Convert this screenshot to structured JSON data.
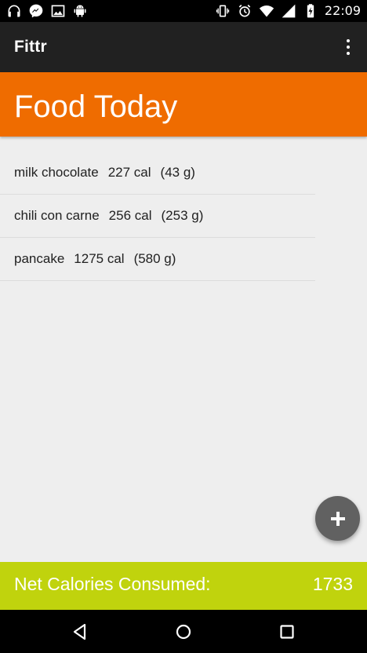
{
  "status_bar": {
    "time": "22:09",
    "left_icons": [
      "headphones-icon",
      "messenger-icon",
      "image-icon",
      "android-icon"
    ],
    "right_icons": [
      "vibrate-icon",
      "alarm-icon",
      "wifi-icon",
      "signal-icon",
      "battery-charging-icon"
    ]
  },
  "app_bar": {
    "title": "Fittr",
    "menu_icon": "overflow-menu-icon"
  },
  "header": {
    "title": "Food Today",
    "color": "#ef6c00"
  },
  "foods": [
    {
      "name": "milk chocolate",
      "calories": "227 cal",
      "weight": "(43 g)"
    },
    {
      "name": "chili con carne",
      "calories": "256 cal",
      "weight": "(253 g)"
    },
    {
      "name": "pancake",
      "calories": "1275 cal",
      "weight": "(580 g)"
    }
  ],
  "fab": {
    "icon": "add-icon"
  },
  "footer": {
    "label": "Net Calories Consumed:",
    "value": "1733",
    "color": "#c0d30d"
  },
  "nav_bar": {
    "buttons": [
      "back-icon",
      "home-icon",
      "recents-icon"
    ]
  }
}
